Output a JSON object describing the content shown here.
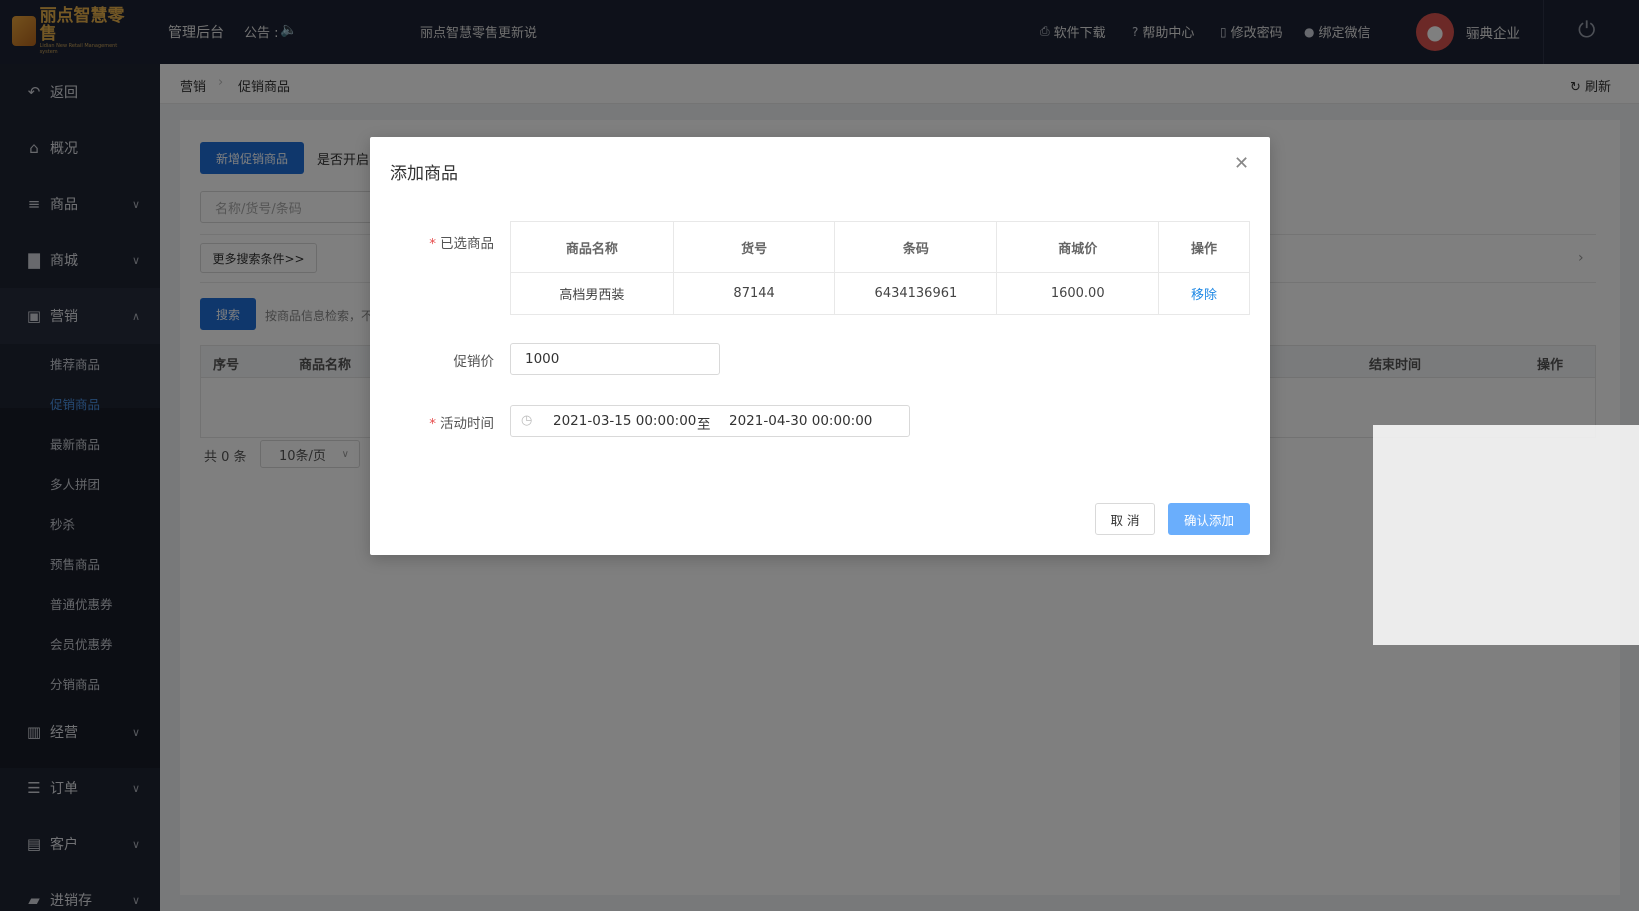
{
  "header": {
    "logo_text": "丽点智慧零售",
    "logo_sub": "Lidian New Retail Management system",
    "admin_link": "管理后台",
    "notice_label": "公告 :",
    "notice_text": "丽点智慧零售更新说",
    "links": [
      {
        "icon": "printer-icon",
        "label": "软件下载"
      },
      {
        "icon": "help-circle-icon",
        "label": "帮助中心"
      },
      {
        "icon": "lock-icon",
        "label": "修改密码"
      },
      {
        "icon": "wechat-icon",
        "label": "绑定微信"
      }
    ],
    "company": "骊典企业"
  },
  "sidebar": {
    "items": [
      {
        "label": "返回",
        "icon": "back-arrow-icon",
        "chev": false
      },
      {
        "label": "概况",
        "icon": "home-icon",
        "chev": false
      },
      {
        "label": "商品",
        "icon": "list-icon",
        "chev": true
      },
      {
        "label": "商城",
        "icon": "shopping-bag-icon",
        "chev": true
      },
      {
        "label": "营销",
        "icon": "gift-icon",
        "chev": true,
        "open": true
      },
      {
        "label": "经营",
        "icon": "bar-chart-icon",
        "chev": true
      },
      {
        "label": "订单",
        "icon": "order-list-icon",
        "chev": true
      },
      {
        "label": "客户",
        "icon": "contact-card-icon",
        "chev": true
      },
      {
        "label": "进销存",
        "icon": "truck-icon",
        "chev": true
      }
    ],
    "sub_items": [
      "推荐商品",
      "促销商品",
      "最新商品",
      "多人拼团",
      "秒杀",
      "预售商品",
      "普通优惠券",
      "会员优惠券",
      "分销商品"
    ],
    "active_sub": "促销商品"
  },
  "breadcrumb": [
    "营销",
    "促销商品"
  ],
  "refresh_label": "刷新",
  "content": {
    "add_button": "新增促销商品",
    "enable_label": "是否开启",
    "search_placeholder": "名称/货号/条码",
    "more_filters": "更多搜索条件>>",
    "search_button": "搜索",
    "search_hint": "按商品信息检索，不",
    "table_headers": [
      "序号",
      "商品名称",
      "结束时间",
      "操作"
    ],
    "total": "共 0 条",
    "page_size": "10条/页"
  },
  "modal": {
    "title": "添加商品",
    "selected_label": "已选商品",
    "columns": [
      "商品名称",
      "货号",
      "条码",
      "商城价",
      "操作"
    ],
    "rows": [
      {
        "name": "高档男西装",
        "sku": "87144",
        "barcode": "6434136961",
        "price": "1600.00",
        "action": "移除"
      }
    ],
    "promo_price_label": "促销价",
    "promo_price_value": "1000",
    "time_label": "活动时间",
    "start_time": "2021-03-15 00:00:00",
    "range_sep": "至",
    "end_time": "2021-04-30 00:00:00",
    "cancel": "取 消",
    "confirm": "确认添加"
  }
}
